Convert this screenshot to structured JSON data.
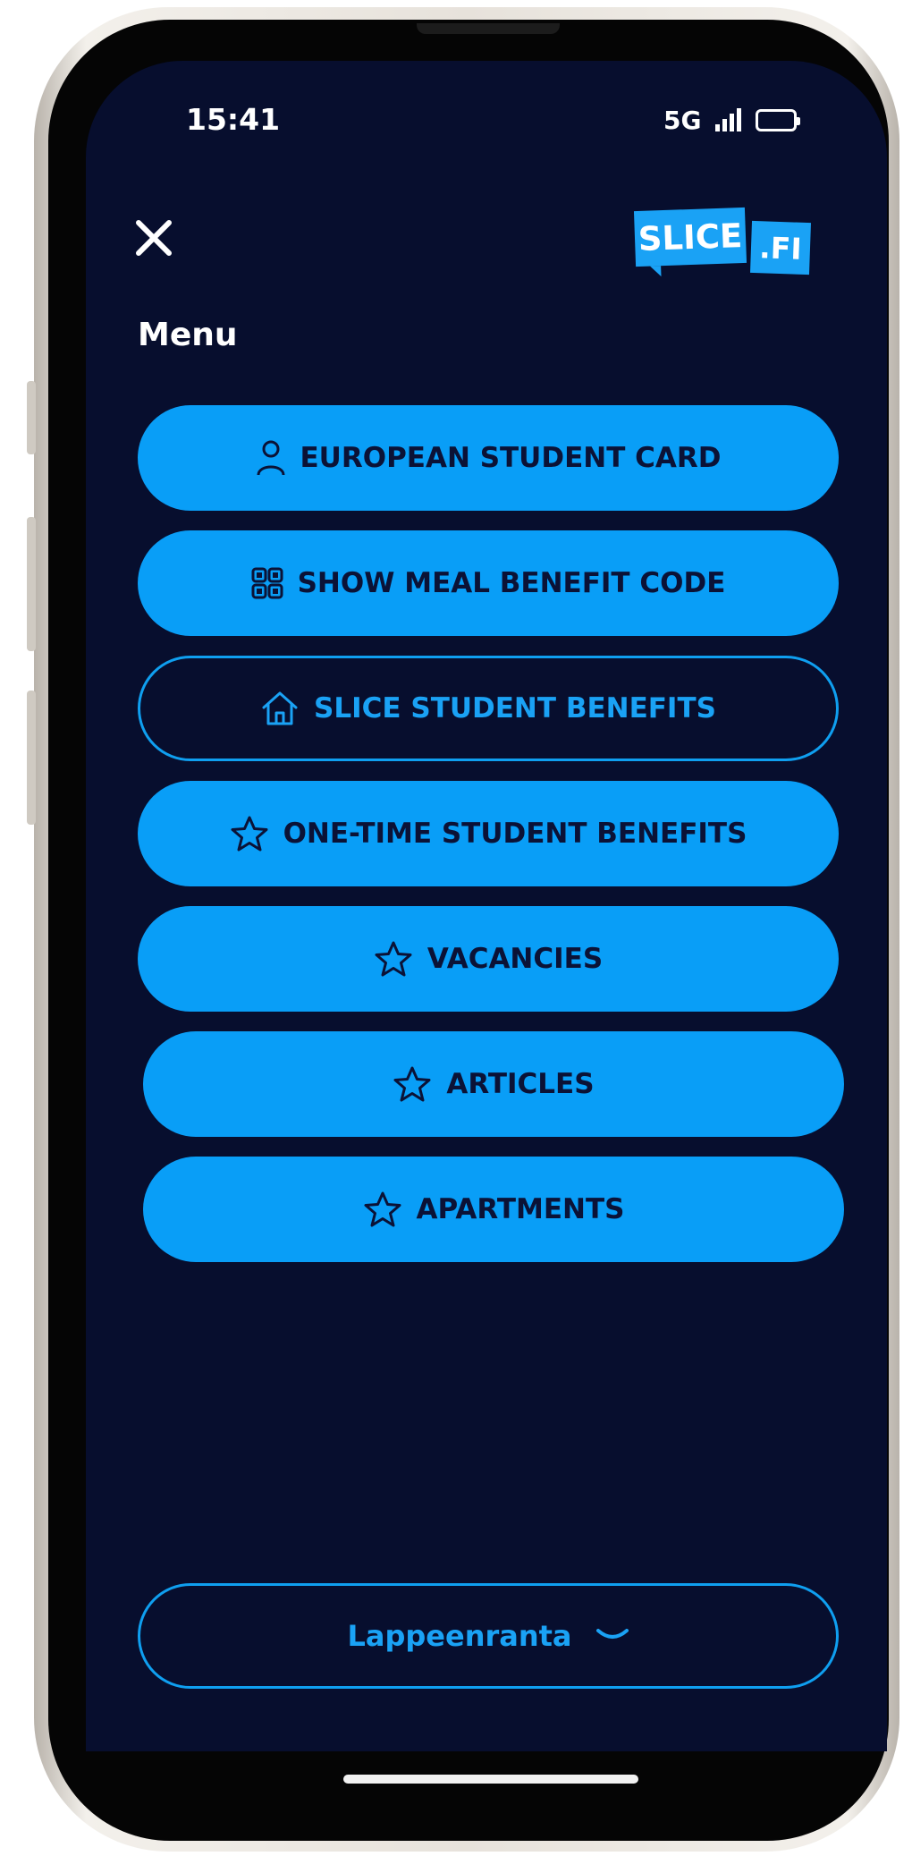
{
  "status_bar": {
    "time": "15:41",
    "network": "5G"
  },
  "header": {
    "logo_left": "SLICE",
    "logo_right": ".FI",
    "title": "Menu"
  },
  "menu": {
    "items": [
      {
        "label": "EUROPEAN STUDENT CARD",
        "icon": "person-icon"
      },
      {
        "label": "SHOW MEAL BENEFIT CODE",
        "icon": "qr-code-icon"
      },
      {
        "label": "SLICE STUDENT BENEFITS",
        "icon": "home-icon",
        "selected": true
      },
      {
        "label": "ONE-TIME STUDENT BENEFITS",
        "icon": "star-icon"
      },
      {
        "label": "VACANCIES",
        "icon": "star-icon"
      },
      {
        "label": "ARTICLES",
        "icon": "star-icon"
      },
      {
        "label": "APARTMENTS",
        "icon": "star-icon"
      }
    ]
  },
  "location": {
    "selected": "Lappeenranta",
    "icon": "chevron-down-icon"
  },
  "colors": {
    "background": "#070e2e",
    "accent": "#099ef7",
    "button_text": "#0b1236"
  }
}
